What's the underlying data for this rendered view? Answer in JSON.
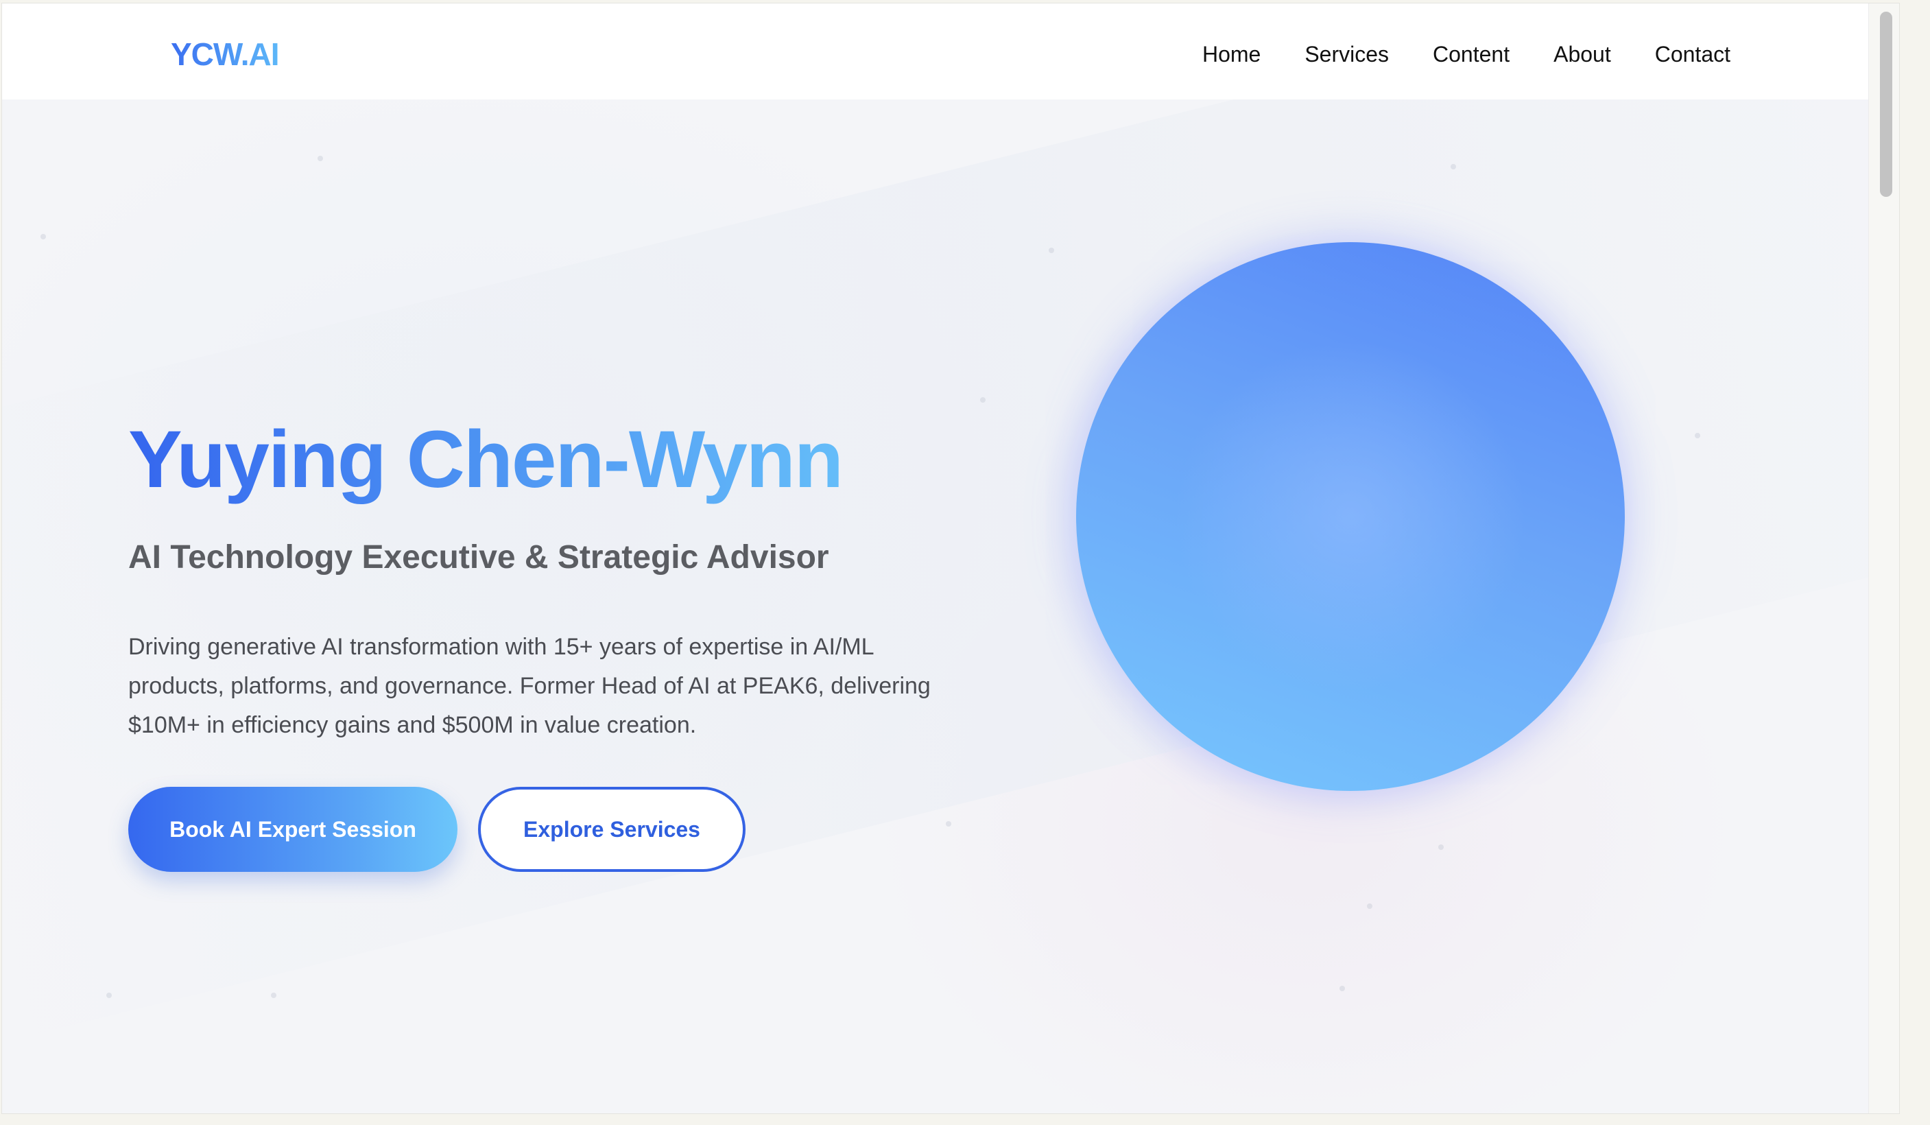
{
  "header": {
    "logo": "YCW.AI",
    "nav": [
      "Home",
      "Services",
      "Content",
      "About",
      "Contact"
    ]
  },
  "hero": {
    "title": "Yuying Chen-Wynn",
    "subtitle": "AI Technology Executive & Strategic Advisor",
    "description": "Driving generative AI transformation with 15+ years of expertise in AI/ML products, platforms, and governance. Former Head of AI at PEAK6, delivering $10M+ in efficiency gains and $500M in value creation.",
    "primary_button": "Book AI Expert Session",
    "secondary_button": "Explore Services"
  },
  "colors": {
    "accent_start": "#3566ee",
    "accent_end": "#65bdf9",
    "text_dark": "#111111",
    "text_muted": "#5b5d62",
    "page_bg": "#f4f5f8"
  },
  "icons": {
    "hero_visual": "gradient-orb"
  }
}
